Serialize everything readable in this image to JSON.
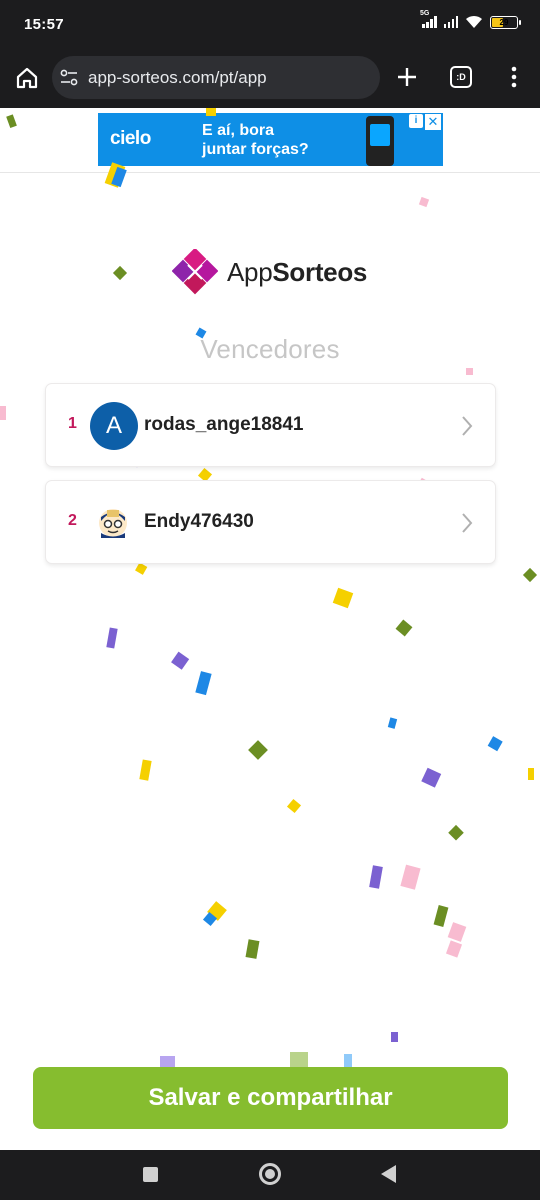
{
  "status_bar": {
    "time": "15:57",
    "network_tag": "5G",
    "battery_level": "29"
  },
  "browser": {
    "url": "app-sorteos.com/pt/app",
    "tabs_glyph": ":D",
    "icons": [
      "home-icon",
      "site-settings-icon",
      "new-tab-plus-icon",
      "tabs-icon",
      "more-vert-icon"
    ]
  },
  "ad": {
    "brand": "cielo",
    "headline_line1": "E aí, bora",
    "headline_line2": "juntar forças?",
    "info_label": "i",
    "close_label": "✕"
  },
  "brand": {
    "name_regular": "App",
    "name_bold": "Sorteos"
  },
  "winners_section": {
    "title": "Vencedores",
    "winners": [
      {
        "rank": "1",
        "name": "rodas_ange18841",
        "avatar_letter": "A",
        "avatar_color": "#0d5fa8"
      },
      {
        "rank": "2",
        "name": "Endy476430",
        "avatar": "cartoon-character-avatar"
      }
    ]
  },
  "actions": {
    "share_label": "Salvar e compartilhar"
  },
  "colors": {
    "accent_green": "#86bd2f",
    "rank_color": "#c2185b",
    "brand_magenta": "#b5179e",
    "bar_dark": "#1c1c1e"
  },
  "nav_bar": {
    "icons": [
      "recent-apps-icon",
      "home-circle-icon",
      "back-triangle-icon"
    ]
  }
}
